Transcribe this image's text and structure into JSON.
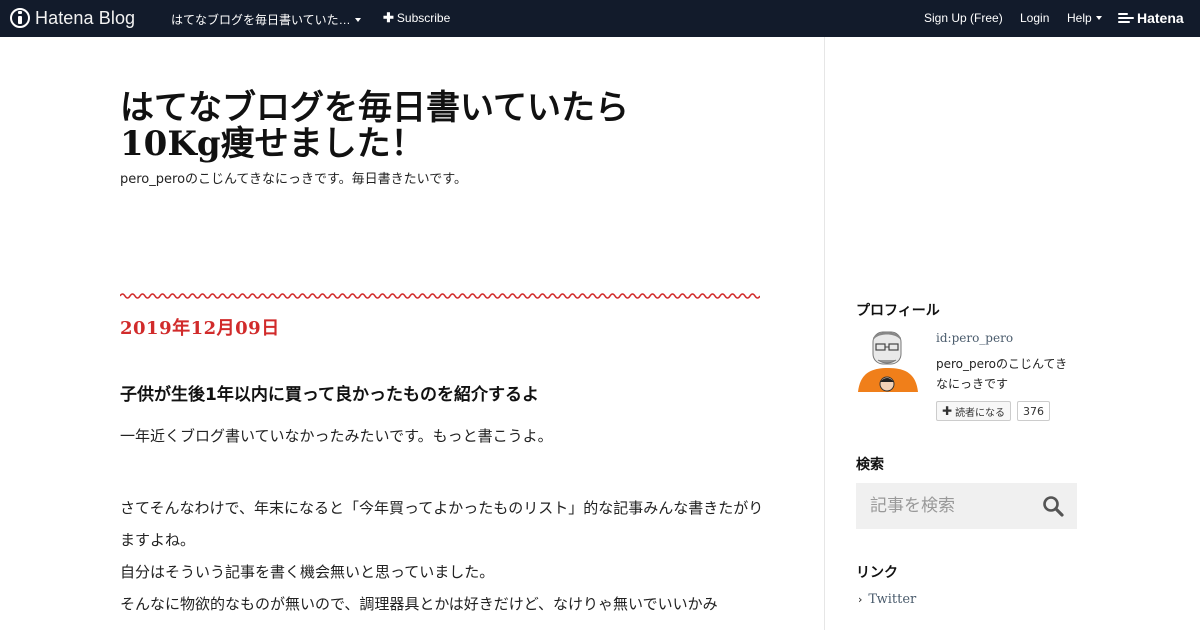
{
  "topbar": {
    "brand": "Hatena Blog",
    "blog_menu_label": "はてなブログを毎日書いていた…",
    "subscribe_label": "Subscribe",
    "signup_label": "Sign Up (Free)",
    "login_label": "Login",
    "help_label": "Help",
    "hatena_label": "Hatena"
  },
  "blog": {
    "title": "はてなブログを毎日書いていたら10Kg痩せました！",
    "description": "pero_peroのこじんてきなにっきです。毎日書きたいです。"
  },
  "entry": {
    "date": "2019年12月09日",
    "title": "子供が生後1年以内に買って良かったものを紹介するよ",
    "paragraphs": [
      "一年近くブログ書いていなかったみたいです。もっと書こうよ。",
      "",
      "さてそんなわけで、年末になると「今年買ってよかったものリスト」的な記事みんな書きたがりますよね。",
      "自分はそういう記事を書く機会無いと思っていました。",
      "そんなに物欲的なものが無いので、調理器具とかは好きだけど、なけりゃ無いでいいかみ"
    ]
  },
  "sidebar": {
    "profile_heading": "プロフィール",
    "profile_id": "id:pero_pero",
    "profile_desc": "pero_peroのこじんてきなにっきです",
    "reader_button": "読者になる",
    "reader_count": "376",
    "search_heading": "検索",
    "search_placeholder": "記事を検索",
    "links_heading": "リンク",
    "links": [
      {
        "label": "Twitter"
      }
    ]
  },
  "colors": {
    "topbar_bg": "#121b2b",
    "date_red": "#d12b2b",
    "link_blue": "#4a5b6c"
  }
}
